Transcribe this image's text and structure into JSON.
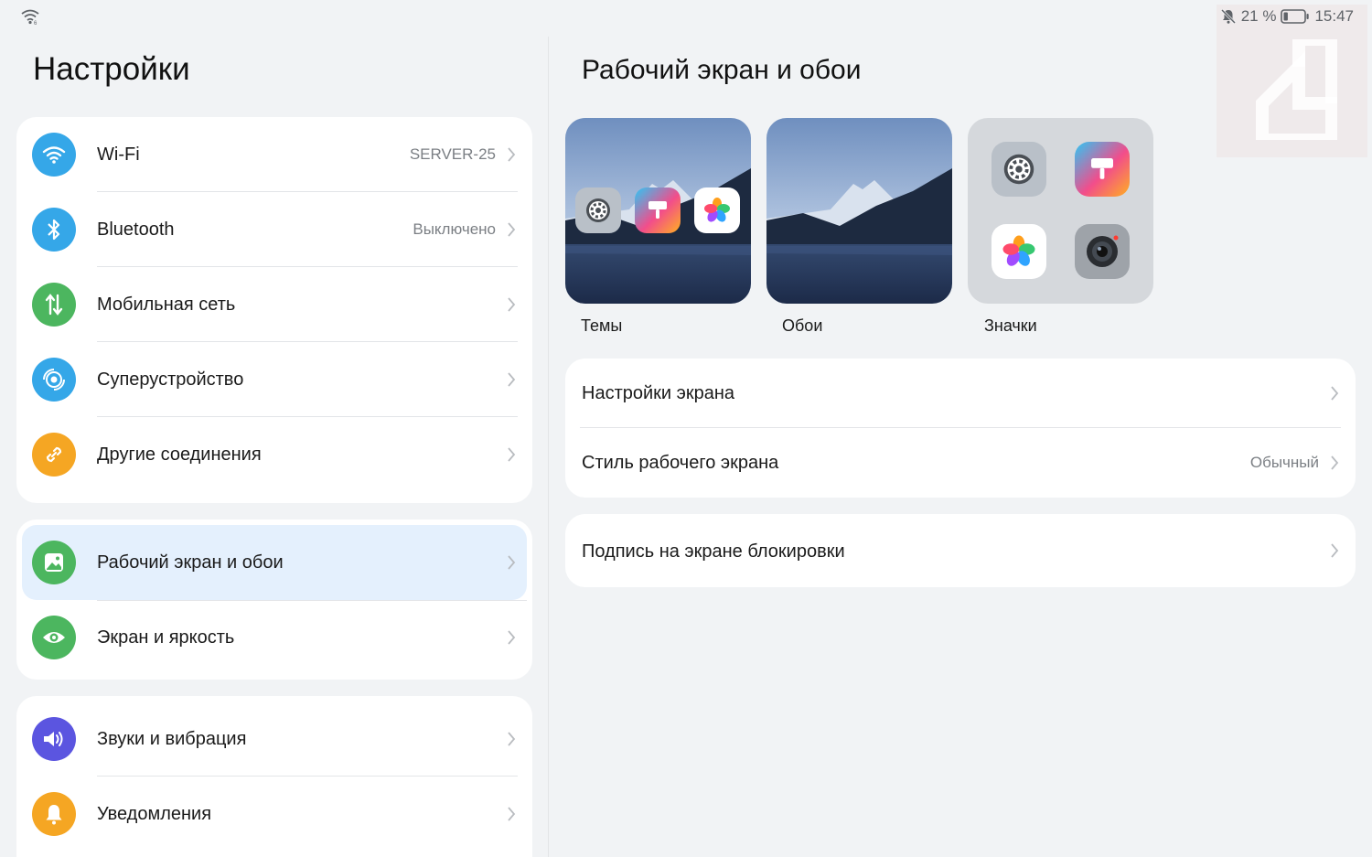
{
  "status_bar": {
    "battery_percent": "21 %",
    "time": "15:47",
    "battery_level": 0.21
  },
  "left": {
    "title": "Настройки",
    "group1": [
      {
        "label": "Wi-Fi",
        "value": "SERVER-25",
        "icon": "wifi-icon",
        "color": "#35a7e8"
      },
      {
        "label": "Bluetooth",
        "value": "Выключено",
        "icon": "bluetooth-icon",
        "color": "#35a7e8"
      },
      {
        "label": "Мобильная сеть",
        "value": "",
        "icon": "mobile-data-icon",
        "color": "#4cb65f"
      },
      {
        "label": "Суперустройство",
        "value": "",
        "icon": "super-device-icon",
        "color": "#35a7e8"
      },
      {
        "label": "Другие соединения",
        "value": "",
        "icon": "link-icon",
        "color": "#f5a623"
      }
    ],
    "group2": [
      {
        "label": "Рабочий экран и обои",
        "icon": "wallpaper-icon",
        "color": "#4cb65f",
        "selected": true
      },
      {
        "label": "Экран и яркость",
        "icon": "eye-icon",
        "color": "#4cb65f"
      }
    ],
    "group3": [
      {
        "label": "Звуки и вибрация",
        "icon": "speaker-icon",
        "color": "#5b55e0"
      },
      {
        "label": "Уведомления",
        "icon": "bell-icon",
        "color": "#f5a623"
      }
    ]
  },
  "right": {
    "title": "Рабочий экран и обои",
    "thumbs": [
      {
        "label": "Темы"
      },
      {
        "label": "Обои"
      },
      {
        "label": "Значки"
      }
    ],
    "card1": [
      {
        "label": "Настройки экрана",
        "value": ""
      },
      {
        "label": "Стиль рабочего экрана",
        "value": "Обычный"
      }
    ],
    "card2": [
      {
        "label": "Подпись на экране блокировки",
        "value": ""
      }
    ]
  },
  "colors": {
    "background": "#f1f3f5",
    "card": "#ffffff",
    "selected": "#e4f0fd",
    "secondary_text": "#7b7f84"
  }
}
